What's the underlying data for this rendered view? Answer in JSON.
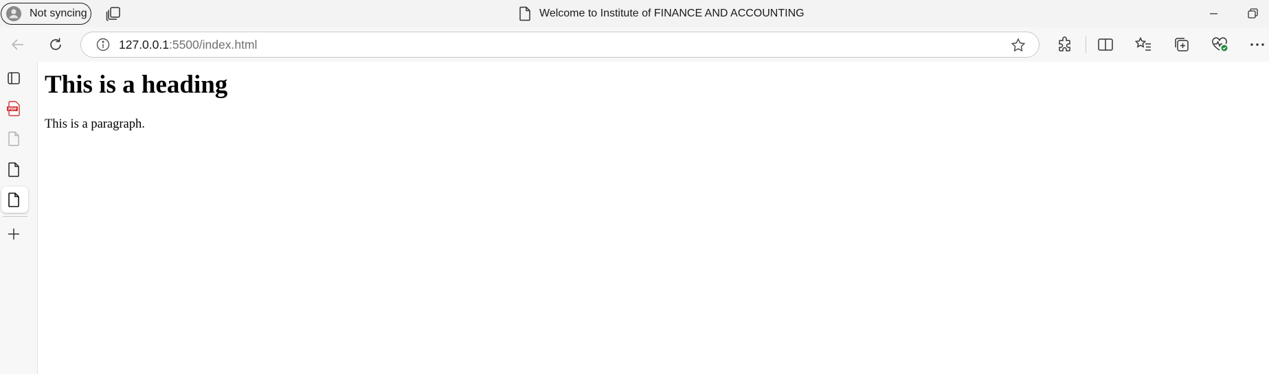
{
  "browser": {
    "profile": {
      "label": "Not syncing",
      "icon": "person-icon"
    },
    "window_title": "Welcome to Institute of FINANCE AND ACCOUNTING",
    "address": {
      "host": "127.0.0.1",
      "rest": ":5500/index.html"
    }
  },
  "page": {
    "heading": "This is a heading",
    "paragraph": "This is a paragraph."
  }
}
